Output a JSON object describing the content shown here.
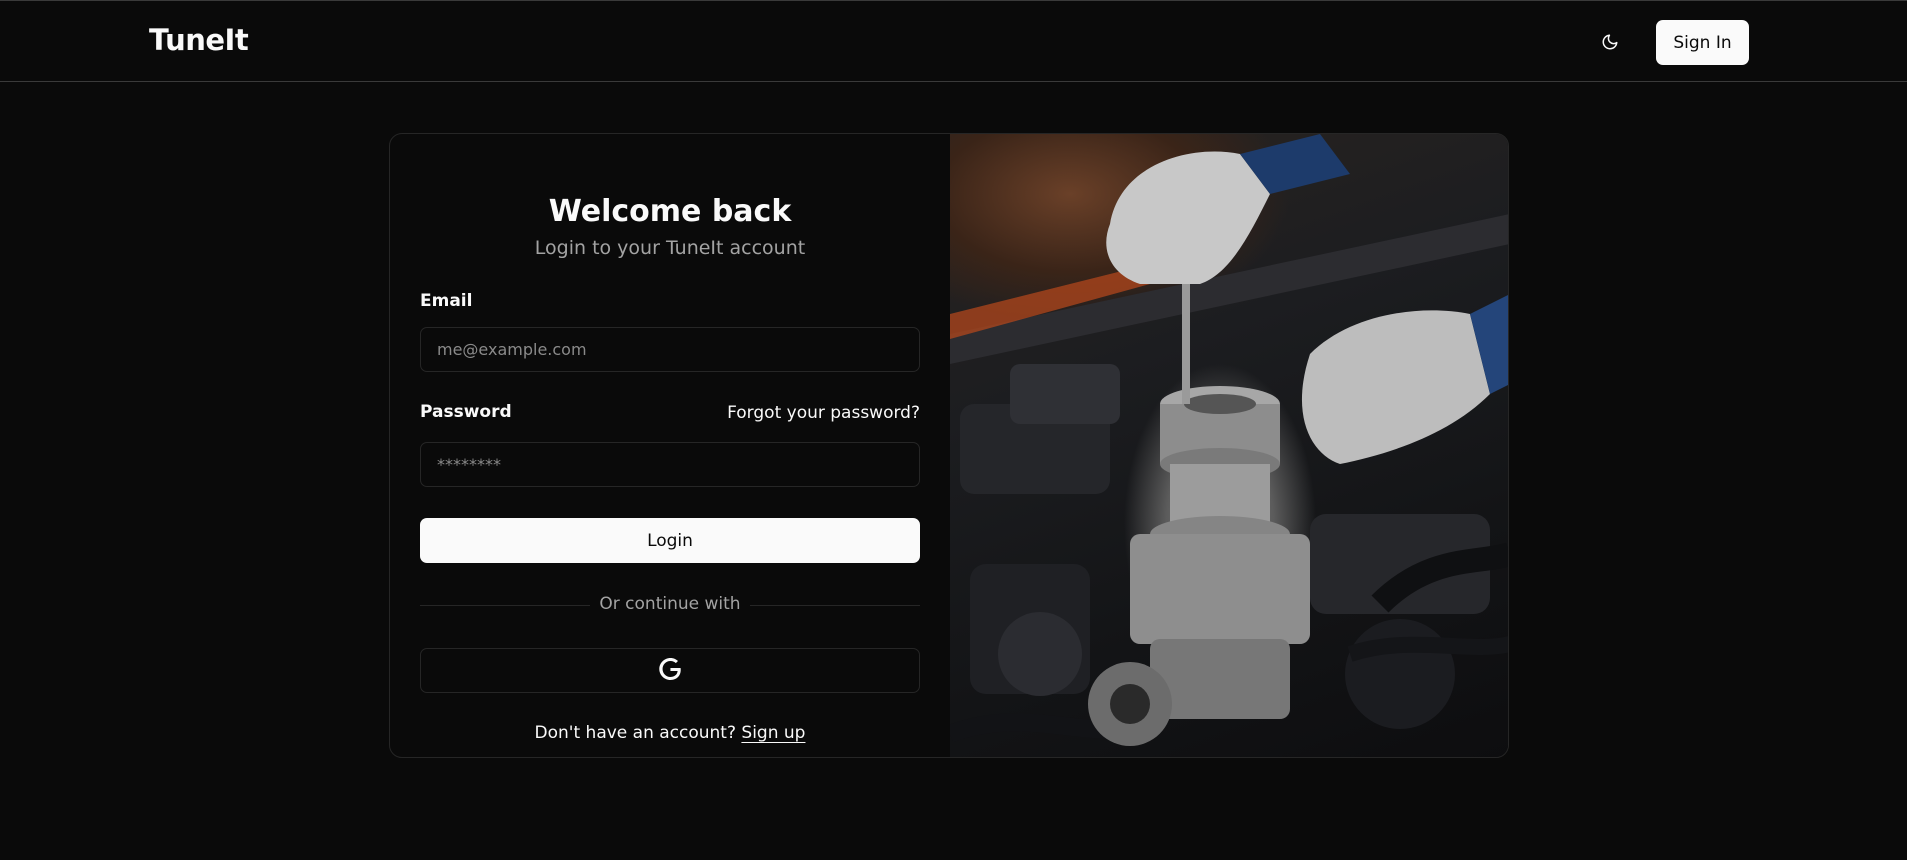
{
  "header": {
    "logo": "TuneIt",
    "theme_toggle_icon": "moon-icon",
    "signin_label": "Sign In"
  },
  "login": {
    "title": "Welcome back",
    "subtitle": "Login to your TuneIt account",
    "email_label": "Email",
    "email_placeholder": "me@example.com",
    "password_label": "Password",
    "forgot_link": "Forgot your password?",
    "password_placeholder": "********",
    "login_button": "Login",
    "divider_text": "Or continue with",
    "google_icon": "google-icon",
    "signup_prompt": "Don't have an account?",
    "signup_link": "Sign up"
  },
  "colors": {
    "background": "#0a0a0a",
    "primary_button": "#fafafa",
    "border": "#262626",
    "muted_text": "#a3a3a3"
  }
}
